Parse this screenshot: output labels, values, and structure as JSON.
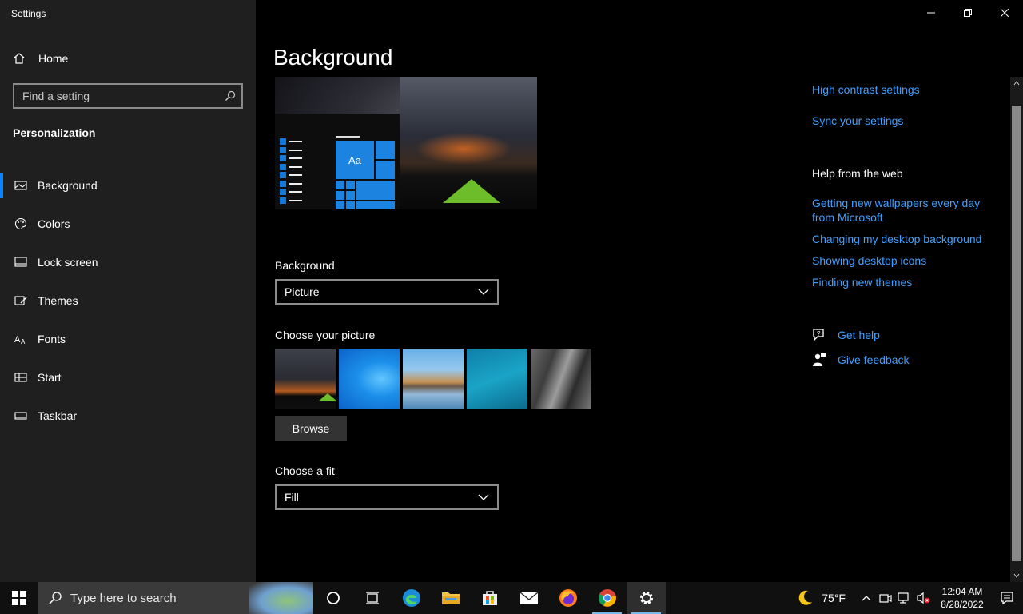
{
  "window": {
    "title": "Settings"
  },
  "sidebar": {
    "home_label": "Home",
    "search_placeholder": "Find a setting",
    "section_title": "Personalization",
    "items": [
      {
        "label": "Background",
        "icon": "picture-icon",
        "active": true
      },
      {
        "label": "Colors",
        "icon": "palette-icon"
      },
      {
        "label": "Lock screen",
        "icon": "lock-screen-icon"
      },
      {
        "label": "Themes",
        "icon": "brush-icon"
      },
      {
        "label": "Fonts",
        "icon": "font-icon"
      },
      {
        "label": "Start",
        "icon": "start-icon"
      },
      {
        "label": "Taskbar",
        "icon": "taskbar-icon"
      }
    ]
  },
  "main": {
    "title": "Background",
    "preview": {
      "tile_text": "Aa"
    },
    "background_label": "Background",
    "background_value": "Picture",
    "choose_picture_label": "Choose your picture",
    "browse_label": "Browse",
    "fit_label": "Choose a fit",
    "fit_value": "Fill"
  },
  "right": {
    "high_contrast": "High contrast settings",
    "sync": "Sync your settings",
    "help_title": "Help from the web",
    "links": [
      "Getting new wallpapers every day from Microsoft",
      "Changing my desktop background",
      "Showing desktop icons",
      "Finding new themes"
    ],
    "get_help": "Get help",
    "give_feedback": "Give feedback"
  },
  "taskbar": {
    "search_placeholder": "Type here to search",
    "weather": "75°F",
    "time": "12:04 AM",
    "date": "8/28/2022"
  },
  "colors": {
    "accent": "#0a84ff",
    "link": "#3fa0ff",
    "sidebar_bg": "#1f1f1f"
  }
}
